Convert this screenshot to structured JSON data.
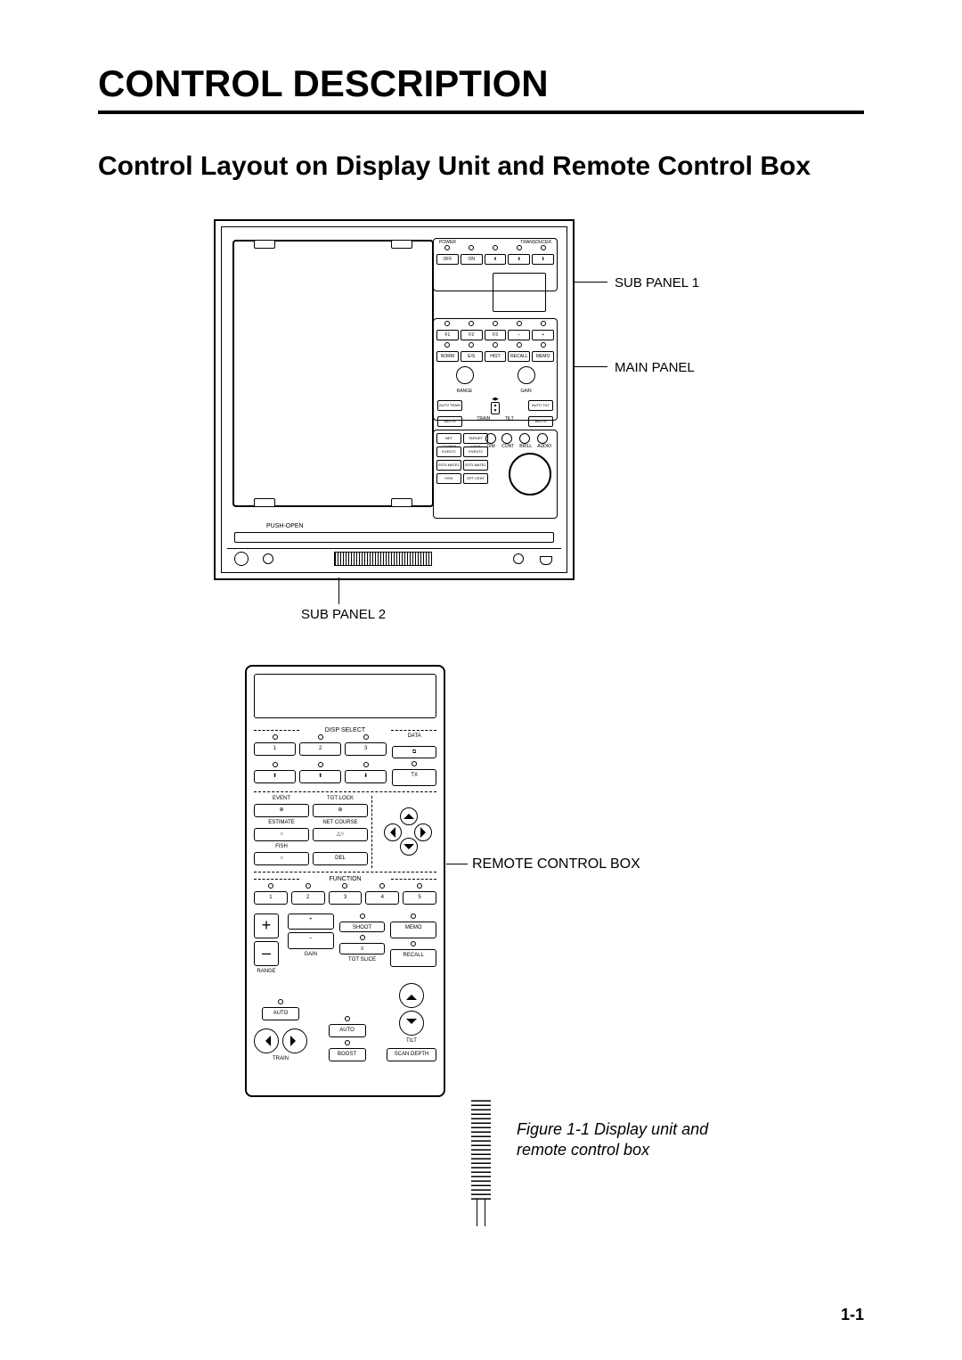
{
  "chapter_title": "CONTROL DESCRIPTION",
  "section_title": "Control Layout on Display Unit and Remote Control Box",
  "callouts": {
    "sub_panel_1": "SUB PANEL 1",
    "main_panel": "MAIN PANEL",
    "sub_panel_2": "SUB PANEL 2",
    "remote": "REMOTE CONTROL BOX"
  },
  "caption": "Figure 1-1 Display unit and remote control box",
  "page_number": "1-1",
  "display_unit": {
    "push_open": "PUSH-OPEN",
    "groups": {
      "power": "POWER",
      "transducer": "TRANSDUCER"
    },
    "sub1_row": [
      "OFF",
      "ON",
      "",
      "",
      ""
    ],
    "main_rows": [
      [
        "F1",
        "F2",
        "F3",
        "–",
        "+"
      ],
      [
        "NORM",
        "E/S",
        "HIST",
        "RECALL",
        "MEMO"
      ]
    ],
    "main_dials": [
      "RANGE",
      "GAIN"
    ],
    "train_tilt": {
      "left": "AUTO TRAIN",
      "right": "AUTO TILT",
      "width_l": "WIDTH",
      "width_r": "WIDTH",
      "train": "TRAIN",
      "tilt": "TILT"
    },
    "lower": {
      "row1": [
        "NET COURSE",
        "TARGET LOCK"
      ],
      "knobs": [
        "DIM",
        "CONT",
        "BRILL",
        "AUDIO"
      ],
      "row2": [
        "EVENT1",
        "EVENT2"
      ],
      "row3": [
        "ESTI-MATE1",
        "ESTI-MATE2"
      ],
      "row4": [
        "FISH",
        "OFF CENT"
      ]
    }
  },
  "remote": {
    "disp_select": "DISP SELECT",
    "disp_row": [
      "1",
      "2",
      "3"
    ],
    "disp_extra": {
      "data": "DATA",
      "tx": "TX"
    },
    "event_tgt": {
      "event": "EVENT",
      "tgt_lock": "TGT LOCK"
    },
    "estimate_net": {
      "estimate": "ESTIMATE",
      "net_course": "NET COURSE"
    },
    "fish": {
      "label": "FISH",
      "del": "DEL"
    },
    "function_label": "FUNCTION",
    "function_row": [
      "1",
      "2",
      "3",
      "4",
      "5"
    ],
    "gain": {
      "plus": "+",
      "minus": "–",
      "label": "GAIN"
    },
    "shoot": "SHOOT",
    "memo": "MEMO",
    "tgt_slice": "TGT SLICE",
    "recall": "RECALL",
    "range_label": "RANGE",
    "auto": "AUTO",
    "boost": "BOOST",
    "train": "TRAIN",
    "tilt": "TILT",
    "scan_depth": "SCAN DEPTH"
  }
}
